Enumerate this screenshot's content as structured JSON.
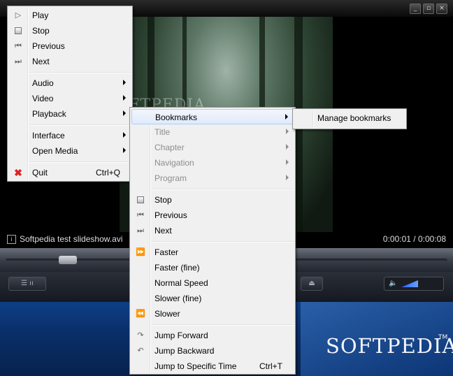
{
  "window": {
    "minimize_icon": "minimize-icon",
    "restore_icon": "restore-icon",
    "close_icon": "close-icon"
  },
  "video": {
    "watermark": "SOFTPEDIA",
    "file_name": "Softpedia test slideshow.avi",
    "time": "0:00:01 / 0:00:08",
    "position_fraction": 0.125
  },
  "main_menu": {
    "items": [
      {
        "label": "Play",
        "icon": "play-icon"
      },
      {
        "label": "Stop",
        "icon": "stop-icon"
      },
      {
        "label": "Previous",
        "icon": "previous-icon"
      },
      {
        "label": "Next",
        "icon": "next-icon"
      },
      {
        "label": "Audio",
        "submenu": true
      },
      {
        "label": "Video",
        "submenu": true
      },
      {
        "label": "Playback",
        "submenu": true
      },
      {
        "label": "Interface",
        "submenu": true
      },
      {
        "label": "Open Media",
        "submenu": true
      },
      {
        "label": "Quit",
        "icon": "quit-icon",
        "shortcut": "Ctrl+Q"
      }
    ]
  },
  "playback_menu": {
    "items": [
      {
        "label": "Bookmarks",
        "submenu": true,
        "highlighted": true
      },
      {
        "label": "Title",
        "submenu": true,
        "disabled": true
      },
      {
        "label": "Chapter",
        "submenu": true,
        "disabled": true
      },
      {
        "label": "Navigation",
        "submenu": true,
        "disabled": true
      },
      {
        "label": "Program",
        "submenu": true,
        "disabled": true
      },
      {
        "label": "Stop",
        "icon": "stop-icon"
      },
      {
        "label": "Previous",
        "icon": "previous-icon"
      },
      {
        "label": "Next",
        "icon": "next-icon"
      },
      {
        "label": "Faster",
        "icon": "faster-icon"
      },
      {
        "label": "Faster (fine)"
      },
      {
        "label": "Normal Speed"
      },
      {
        "label": "Slower (fine)"
      },
      {
        "label": "Slower",
        "icon": "slower-icon"
      },
      {
        "label": "Jump Forward",
        "icon": "jump-forward-icon"
      },
      {
        "label": "Jump Backward",
        "icon": "jump-backward-icon"
      },
      {
        "label": "Jump to Specific Time",
        "shortcut": "Ctrl+T"
      }
    ]
  },
  "bookmarks_menu": {
    "items": [
      {
        "label": "Manage bookmarks"
      }
    ]
  },
  "desktop": {
    "brand": "SOFTPEDIA",
    "trademark": "TM"
  },
  "colors": {
    "menu_bg": "#f0f0f0",
    "highlight": "#dfeafb",
    "desktop_blue": "#0d3f87"
  }
}
